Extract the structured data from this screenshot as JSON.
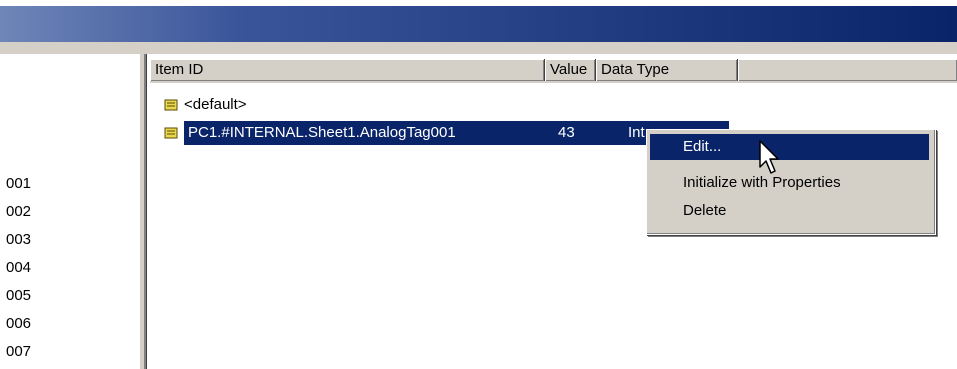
{
  "left_tree": {
    "items": [
      "001",
      "002",
      "003",
      "004",
      "005",
      "006",
      "007"
    ]
  },
  "list": {
    "columns": [
      {
        "label": "Item ID"
      },
      {
        "label": "Value"
      },
      {
        "label": "Data Type"
      }
    ],
    "rows": [
      {
        "item_id": "<default>",
        "value": "",
        "data_type": "",
        "icon": "tag-scroll-icon"
      },
      {
        "item_id": "PC1.#INTERNAL.Sheet1.AnalogTag001",
        "value": "43",
        "data_type": "Int",
        "icon": "tag-scroll-icon",
        "selected": true
      }
    ]
  },
  "context_menu": {
    "items": [
      {
        "label": "Edit...",
        "highlighted": true
      },
      {
        "label": "Initialize with Properties"
      },
      {
        "label": "Delete"
      }
    ]
  },
  "colors": {
    "title_bar": "#0a246a",
    "selection": "#0a246a",
    "face": "#d4d0c8"
  }
}
